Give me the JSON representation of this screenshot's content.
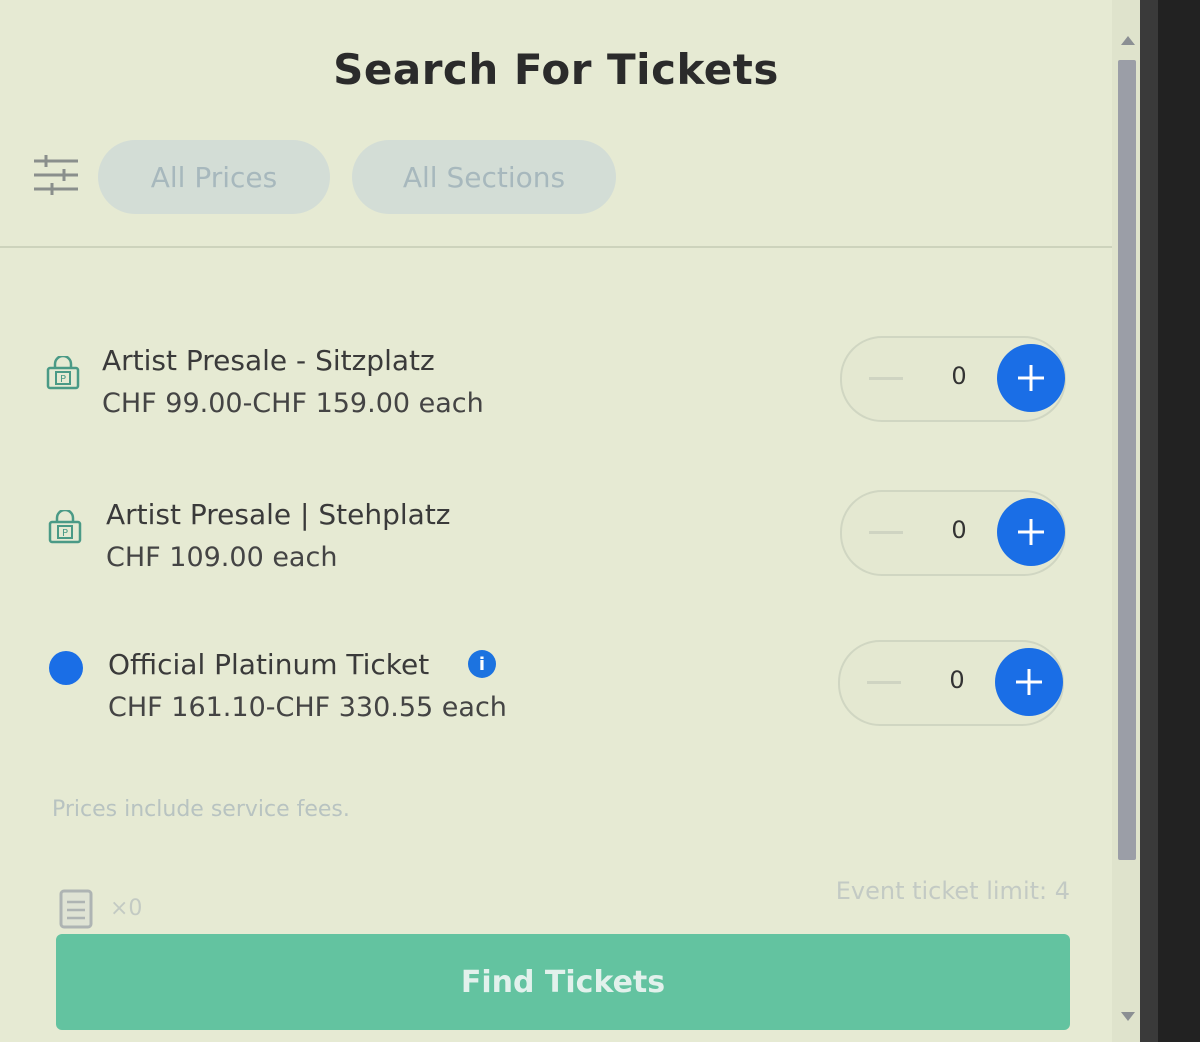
{
  "title": "Search For Tickets",
  "filters": {
    "prices_label": "All Prices",
    "sections_label": "All Sections"
  },
  "tickets": [
    {
      "name": "Artist Presale - Sitzplatz",
      "price": "CHF 99.00-CHF 159.00 each",
      "quantity": "0",
      "icon": "lock-icon"
    },
    {
      "name": "Artist Presale | Stehplatz",
      "price": "CHF 109.00 each",
      "quantity": "0",
      "icon": "lock-icon"
    },
    {
      "name": "Official Platinum Ticket",
      "price": "CHF 161.10-CHF 330.55 each",
      "quantity": "0",
      "icon": "platinum-dot-icon",
      "info": "i"
    }
  ],
  "fees_note": "Prices include service fees.",
  "cart": {
    "count": "×0"
  },
  "limit_text": "Event ticket limit: 4",
  "find_button": "Find Tickets",
  "colors": {
    "accent_blue": "#1a6ee6",
    "find_button": "#63c3a0",
    "background": "#e6ead3"
  }
}
